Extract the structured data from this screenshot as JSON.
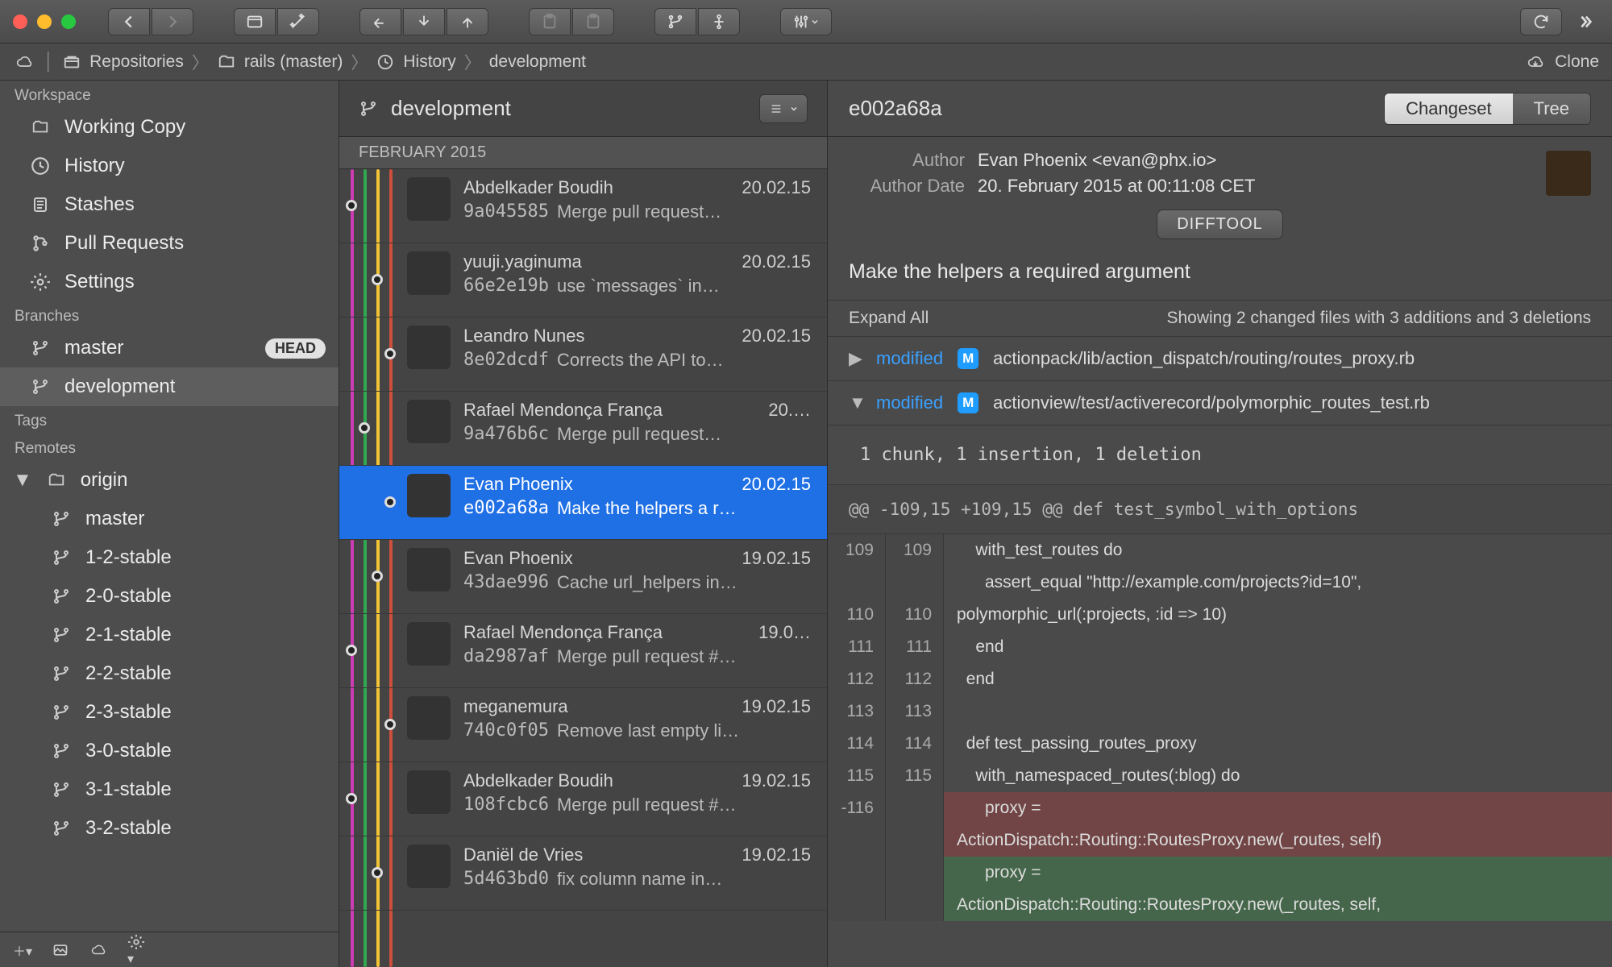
{
  "breadcrumbs": {
    "repositories": "Repositories",
    "repo": "rails (master)",
    "history": "History",
    "branch": "development",
    "clone": "Clone"
  },
  "sidebar": {
    "sections": {
      "workspace": "Workspace",
      "branches": "Branches",
      "tags": "Tags",
      "remotes": "Remotes"
    },
    "workspace_items": [
      {
        "label": "Working Copy"
      },
      {
        "label": "History"
      },
      {
        "label": "Stashes"
      },
      {
        "label": "Pull Requests"
      },
      {
        "label": "Settings"
      }
    ],
    "branches": [
      {
        "label": "master",
        "head": "HEAD"
      },
      {
        "label": "development",
        "selected": true
      }
    ],
    "remote_name": "origin",
    "remote_branches": [
      {
        "label": "master"
      },
      {
        "label": "1-2-stable"
      },
      {
        "label": "2-0-stable"
      },
      {
        "label": "2-1-stable"
      },
      {
        "label": "2-2-stable"
      },
      {
        "label": "2-3-stable"
      },
      {
        "label": "3-0-stable"
      },
      {
        "label": "3-1-stable"
      },
      {
        "label": "3-2-stable"
      }
    ]
  },
  "commitpane": {
    "branch": "development",
    "month": "FEBRUARY 2015",
    "commits": [
      {
        "author": "Abdelkader Boudih",
        "date": "20.02.15",
        "sha": "9a045585",
        "msg": "Merge pull request…",
        "av": "av-dark"
      },
      {
        "author": "yuuji.yaginuma",
        "date": "20.02.15",
        "sha": "66e2e19b",
        "msg": "use `messages` in…",
        "av": "av-green"
      },
      {
        "author": "Leandro Nunes",
        "date": "20.02.15",
        "sha": "8e02dcdf",
        "msg": "Corrects the API to…",
        "av": "av-skin"
      },
      {
        "author": "Rafael Mendonça França",
        "date": "20.…",
        "sha": "9a476b6c",
        "msg": "Merge pull request…",
        "av": "av-skin"
      },
      {
        "author": "Evan Phoenix",
        "date": "20.02.15",
        "sha": "e002a68a",
        "msg": "Make the helpers a r…",
        "selected": true,
        "av": "av-dark"
      },
      {
        "author": "Evan Phoenix",
        "date": "19.02.15",
        "sha": "43dae996",
        "msg": "Cache url_helpers in…",
        "av": "av-dark"
      },
      {
        "author": "Rafael Mendonça França",
        "date": "19.0…",
        "sha": "da2987af",
        "msg": "Merge pull request #…",
        "av": "av-skin"
      },
      {
        "author": "meganemura",
        "date": "19.02.15",
        "sha": "740c0f05",
        "msg": "Remove last empty li…",
        "av": "av-gray"
      },
      {
        "author": "Abdelkader Boudih",
        "date": "19.02.15",
        "sha": "108fcbc6",
        "msg": "Merge pull request #…",
        "av": "av-dark"
      },
      {
        "author": "Daniël de Vries",
        "date": "19.02.15",
        "sha": "5d463bd0",
        "msg": "fix column name in…",
        "av": "av-skin"
      }
    ]
  },
  "detail": {
    "sha": "e002a68a",
    "seg_changeset": "Changeset",
    "seg_tree": "Tree",
    "author_label": "Author",
    "author_value": "Evan Phoenix <evan@phx.io>",
    "date_label": "Author Date",
    "date_value": "20. February 2015 at 00:11:08 CET",
    "difftool": "DIFFTOOL",
    "title": "Make the helpers a required argument",
    "expand_all": "Expand All",
    "summary": "Showing 2 changed files with 3 additions and 3 deletions",
    "files": [
      {
        "expanded": false,
        "status": "modified",
        "badge": "M",
        "path": "actionpack/lib/action_dispatch/routing/routes_proxy.rb"
      },
      {
        "expanded": true,
        "status": "modified",
        "badge": "M",
        "path": "actionview/test/activerecord/polymorphic_routes_test.rb"
      }
    ],
    "chunk_summary": "1 chunk, 1 insertion, 1 deletion",
    "hunk": "@@ -109,15 +109,15 @@ def test_symbol_with_options",
    "diff": [
      {
        "old": "109",
        "new": "109",
        "kind": "ctx",
        "code": "    with_test_routes do"
      },
      {
        "old": "",
        "new": "",
        "kind": "ctx",
        "code": "      assert_equal \"http://example.com/projects?id=10\","
      },
      {
        "old": "110",
        "new": "110",
        "kind": "ctx",
        "code": "polymorphic_url(:projects, :id => 10)"
      },
      {
        "old": "111",
        "new": "111",
        "kind": "ctx",
        "code": "    end"
      },
      {
        "old": "112",
        "new": "112",
        "kind": "ctx",
        "code": "  end"
      },
      {
        "old": "113",
        "new": "113",
        "kind": "ctx",
        "code": ""
      },
      {
        "old": "114",
        "new": "114",
        "kind": "ctx",
        "code": "  def test_passing_routes_proxy"
      },
      {
        "old": "115",
        "new": "115",
        "kind": "ctx",
        "code": "    with_namespaced_routes(:blog) do"
      },
      {
        "old": "-116",
        "new": "",
        "kind": "del",
        "code": "      proxy ="
      },
      {
        "old": "",
        "new": "",
        "kind": "del",
        "code": "ActionDispatch::Routing::RoutesProxy.new(_routes, self)"
      },
      {
        "old": "",
        "new": "",
        "kind": "add",
        "code": "      proxy ="
      },
      {
        "old": "",
        "new": "",
        "kind": "add",
        "code": "ActionDispatch::Routing::RoutesProxy.new(_routes, self,"
      }
    ]
  }
}
